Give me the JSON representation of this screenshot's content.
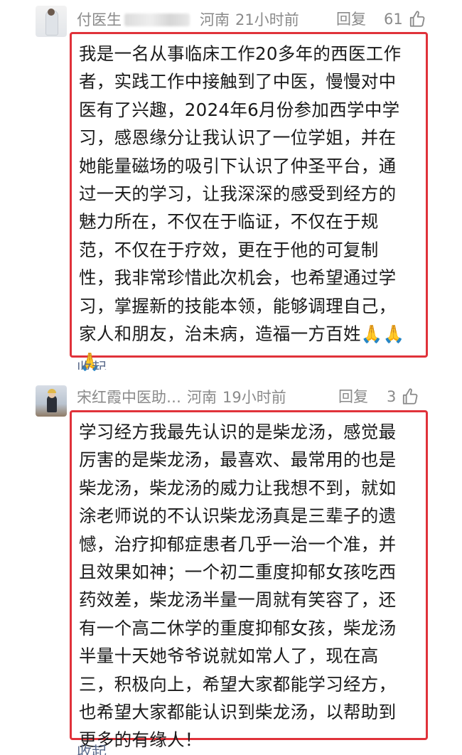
{
  "comments": [
    {
      "nickname": "付医生",
      "location": "河南",
      "time": "21小时前",
      "reply_label": "回复",
      "likes": "61",
      "lines": [
        "我是一名从事临床工作20多年的西医工作",
        "者，实践工作中接触到了中医，慢慢对中",
        "医有了兴趣，2024年6月份参加西学中学",
        "习，感恩缘分让我认识了一位学姐，并在",
        "她能量磁场的吸引下认识了仲圣平台，通",
        "过一天的学习，让我深深的感受到经方的",
        "魅力所在，不仅在于临证，不仅在于规",
        "范，不仅在于疗效，更在于他的可复制",
        "性，我非常珍惜此次机会，也希望通过学",
        "习，掌握新的技能本领，能够调理自己，",
        "家人和朋友，治未病，造福一方百姓🙏🙏",
        "🙏"
      ],
      "collapse_label": "收起"
    },
    {
      "nickname": "宋红霞中医助…",
      "location": "河南",
      "time": "19小时前",
      "reply_label": "回复",
      "likes": "3",
      "lines": [
        "学习经方我最先认识的是柴龙汤，感觉最",
        "厉害的是柴龙汤，最喜欢、最常用的也是",
        "柴龙汤，柴龙汤的威力让我想不到，就如",
        "涂老师说的不认识柴龙汤真是三辈子的遗",
        "憾，治疗抑郁症患者几乎一治一个准，并",
        "且效果如神；一个初二重度抑郁女孩吃西",
        "药效差，柴龙汤半量一周就有笑容了，还",
        "有一个高二休学的重度抑郁女孩，柴龙汤",
        "半量十天她爷爷说就如常人了，现在高",
        "三，积极向上，希望大家都能学习经方，",
        "也希望大家都能认识到柴龙汤，以帮助到",
        "更多的有缘人！"
      ],
      "collapse_label": "收起"
    }
  ],
  "colors": {
    "highlight_border": "#e0323a",
    "meta_text": "#8a8a8a",
    "link": "#5b6b8c"
  },
  "icons": {
    "like": "thumbs-up-outline"
  }
}
